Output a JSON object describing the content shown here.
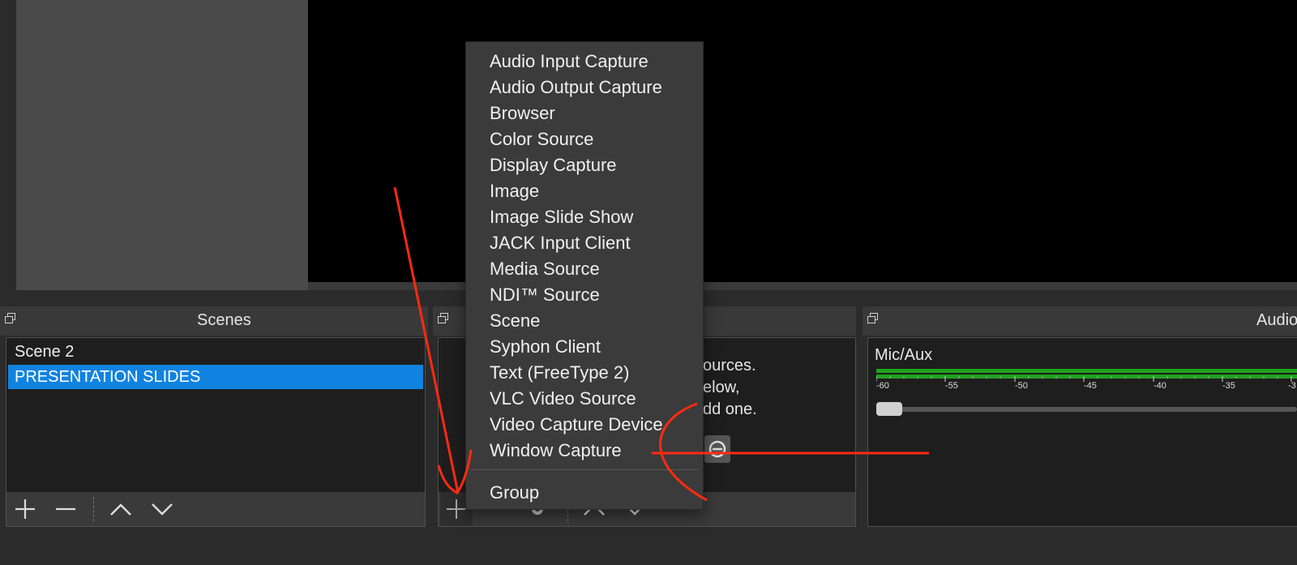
{
  "scenes_dock": {
    "title": "Scenes",
    "items": [
      {
        "label": "Scene 2",
        "selected": false
      },
      {
        "label": "PRESENTATION SLIDES",
        "selected": true
      }
    ]
  },
  "sources_dock": {
    "empty_text_line1": "ources.",
    "empty_text_line2": "elow,",
    "empty_text_line3": "dd one."
  },
  "audio_dock": {
    "title": "Audio",
    "channel_label": "Mic/Aux",
    "ticks": [
      "-60",
      "-55",
      "-50",
      "-45",
      "-40",
      "-35",
      "-3"
    ]
  },
  "add_source_menu": {
    "items": [
      "Audio Input Capture",
      "Audio Output Capture",
      "Browser",
      "Color Source",
      "Display Capture",
      "Image",
      "Image Slide Show",
      "JACK Input Client",
      "Media Source",
      "NDI™ Source",
      "Scene",
      "Syphon Client",
      "Text (FreeType 2)",
      "VLC Video Source",
      "Video Capture Device",
      "Window Capture"
    ],
    "group_item": "Group"
  },
  "colors": {
    "selection": "#1083e0",
    "annotation": "#ff2a12",
    "meter_green": "#1fa31f"
  }
}
